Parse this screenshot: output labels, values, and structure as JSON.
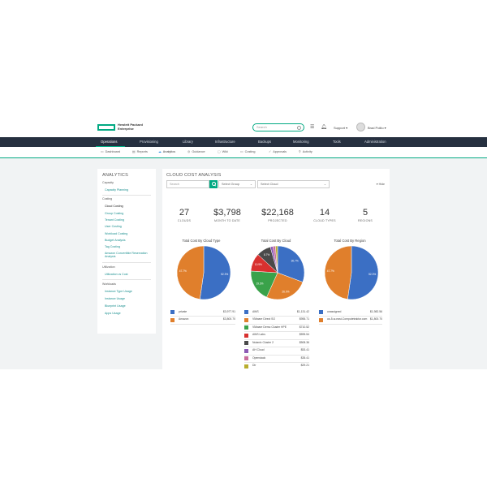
{
  "brand": {
    "line1": "Hewlett Packard",
    "line2": "Enterprise"
  },
  "header": {
    "search_placeholder": "Search",
    "support_label": "Support ▾",
    "user_label": "Brad Polito ▾"
  },
  "main_nav": [
    {
      "label": "Operations",
      "active": true
    },
    {
      "label": "Provisioning"
    },
    {
      "label": "Library"
    },
    {
      "label": "Infrastructure"
    },
    {
      "label": "Backups"
    },
    {
      "label": "Monitoring"
    },
    {
      "label": "Tools"
    },
    {
      "label": "Administration"
    }
  ],
  "sub_nav": [
    {
      "label": "Dashboard",
      "icon": "dashboard-icon"
    },
    {
      "label": "Reports",
      "icon": "reports-icon"
    },
    {
      "label": "Analytics",
      "icon": "analytics-icon",
      "active": true
    },
    {
      "label": "Guidance",
      "icon": "guidance-icon"
    },
    {
      "label": "Wiki",
      "icon": "wiki-icon"
    },
    {
      "label": "Costing",
      "icon": "costing-icon"
    },
    {
      "label": "Approvals",
      "icon": "approvals-icon"
    },
    {
      "label": "Activity",
      "icon": "activity-icon"
    }
  ],
  "sidebar": {
    "title": "ANALYTICS",
    "sections": [
      {
        "heading": "Capacity",
        "items": [
          {
            "label": "Capacity Planning"
          }
        ]
      },
      {
        "heading": "Costing",
        "items": [
          {
            "label": "Cloud Costing",
            "active": true
          },
          {
            "label": "Group Costing"
          },
          {
            "label": "Tenant Costing"
          },
          {
            "label": "User Costing"
          },
          {
            "label": "Workload Costing"
          },
          {
            "label": "Budget Analysis"
          },
          {
            "label": "Tag Costing"
          },
          {
            "label": "Amazon Convertible Reservation Analysis"
          }
        ]
      },
      {
        "heading": "Utilization",
        "items": [
          {
            "label": "Utilization vs Cost"
          }
        ]
      },
      {
        "heading": "Workloads",
        "items": [
          {
            "label": "Instance Type Usage"
          },
          {
            "label": "Instance Usage"
          },
          {
            "label": "Blueprint Usage"
          },
          {
            "label": "Apps Usage"
          }
        ]
      }
    ]
  },
  "main": {
    "title": "CLOUD COST ANALYSIS",
    "hide_label": "▾ Hide",
    "filters": {
      "search_placeholder": "Search",
      "group_select": "Select Group",
      "cloud_select": "Select Cloud"
    },
    "stats": [
      {
        "value": "27",
        "label": "CLOUDS"
      },
      {
        "value": "$3,798",
        "label": "MONTH TO DATE"
      },
      {
        "value": "$22,168",
        "label": "PROJECTED"
      },
      {
        "value": "14",
        "label": "CLOUD TYPES"
      },
      {
        "value": "5",
        "label": "REGIONS"
      }
    ]
  },
  "charts": {
    "by_cloud_type": {
      "title": "Total Cost By Cloud Type",
      "slices": [
        {
          "name": "private",
          "value": 52.3,
          "label": "52.3%",
          "color": "#3b6fc4"
        },
        {
          "name": "Amazon",
          "value": 47.7,
          "label": "47.7%",
          "color": "#e07f2c"
        }
      ],
      "legend_values": [
        "$3,977.91",
        "$3,800.70"
      ]
    },
    "by_cloud": {
      "title": "Total Cost By Cloud",
      "slices": [
        {
          "name": "AWS",
          "value": 30.7,
          "label": "30.7%",
          "color": "#3b6fc4"
        },
        {
          "name": "VMware Direct SO",
          "value": 26.0,
          "label": "26.0%",
          "color": "#e07f2c"
        },
        {
          "name": "VMware Demo Cluster HPE",
          "value": 19.3,
          "label": "19.3%",
          "color": "#3aa24a"
        },
        {
          "name": "AWS Labs",
          "value": 10.9,
          "label": "10.9%",
          "color": "#d8312f"
        },
        {
          "name": "Nutanix Cluster 2",
          "value": 8.7,
          "label": "8.7%",
          "color": "#4a4a4a"
        },
        {
          "name": "AH Cloud",
          "value": 1.6,
          "label": "",
          "color": "#8e5bb5"
        },
        {
          "name": "Openstack",
          "value": 1.5,
          "label": "",
          "color": "#c96d9c"
        },
        {
          "name": "Dir",
          "value": 1.3,
          "label": "",
          "color": "#b8ad2e"
        }
      ],
      "legend_values": [
        "$1,131.42",
        "$955.71",
        "$710.52",
        "$595.54",
        "$508.36",
        "$53.41",
        "$35.41",
        "$29.21"
      ]
    },
    "by_region": {
      "title": "Total Cost By Region",
      "slices": [
        {
          "name": "unassigned",
          "value": 52.3,
          "label": "52.3%",
          "color": "#3b6fc4"
        },
        {
          "name": "us-5-w-east-Computetraktor.com",
          "value": 47.7,
          "label": "47.7%",
          "color": "#e07f2c"
        }
      ],
      "legend_values": [
        "$1,982.56",
        "$1,800.70"
      ]
    }
  }
}
